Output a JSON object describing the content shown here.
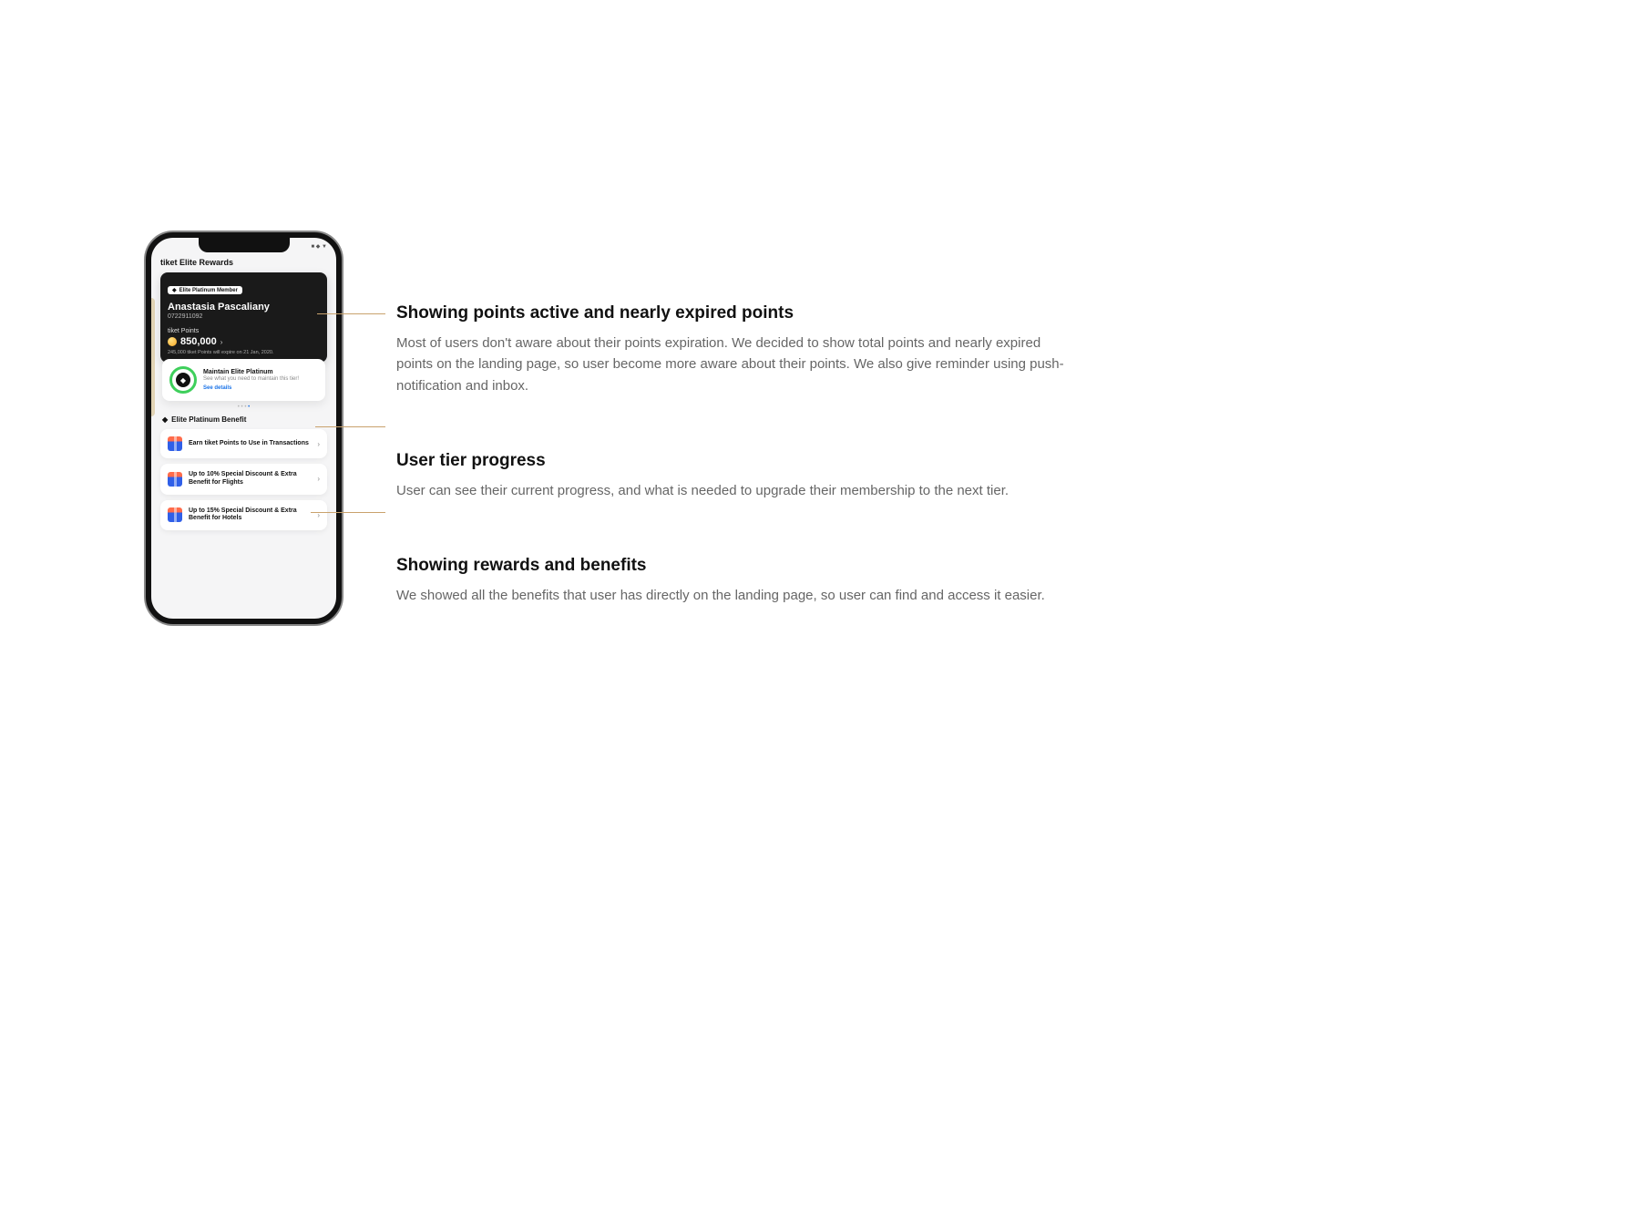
{
  "phone": {
    "app_title": "tiket Elite Rewards",
    "status_icons": "■ ◆ ▼",
    "card": {
      "tier_badge": "Elite Platinum Member",
      "user_name": "Anastasia Pascaliany",
      "user_id": "0722911092",
      "points_label": "tiket Points",
      "points_value": "850,000",
      "expire_note": "245,000 tiket Points will expire on 21 Jan, 2020."
    },
    "progress": {
      "title": "Maintain Elite Platinum",
      "subtitle": "See what you need to maintain this tier!",
      "cta": "See details"
    },
    "benefit_section_title": "Elite Platinum Benefit",
    "benefits": [
      {
        "label": "Earn tiket Points to Use in Transactions"
      },
      {
        "label": "Up to 10% Special Discount & Extra Benefit for Flights"
      },
      {
        "label": "Up to 15% Special Discount & Extra Benefit for Hotels"
      }
    ]
  },
  "annotations": [
    {
      "title": "Showing points active and nearly expired points",
      "body": "Most of users don't aware about their points expiration. We decided to show total points and nearly expired points on the landing page, so user become more aware about their points. We also give reminder using push-notification and inbox."
    },
    {
      "title": "User tier progress",
      "body": "User can see their current progress, and what is needed to upgrade their membership to the next tier."
    },
    {
      "title": "Showing rewards and benefits",
      "body": "We showed all the benefits that user has directly on the landing page, so user can find and access it easier."
    }
  ]
}
